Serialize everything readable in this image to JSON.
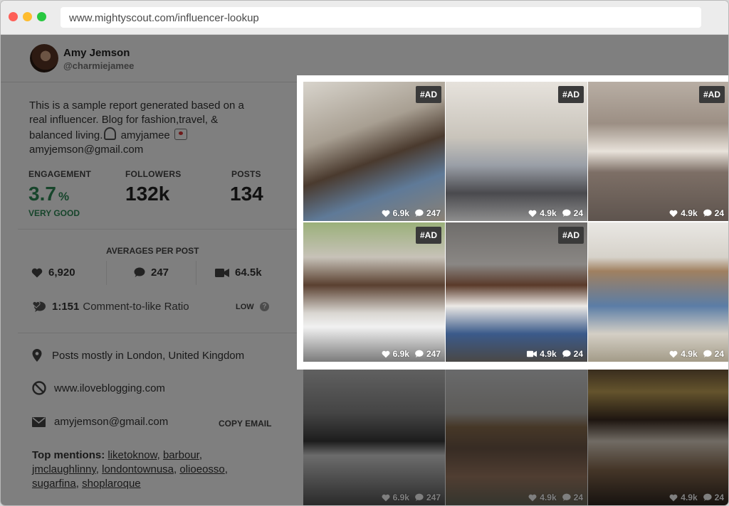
{
  "browser": {
    "url": "www.mightyscout.com/influencer-lookup"
  },
  "profile": {
    "name": "Amy Jemson",
    "handle": "@charmiejamee"
  },
  "bio": {
    "line1": "This is a sample report generated based on a",
    "line2": "real influencer. Blog for fashion,travel, &",
    "line3_text": "balanced living.",
    "line3_handle": "amyjamee",
    "line4": "amyjemson@gmail.com"
  },
  "stats": {
    "engagement_label": "ENGAGEMENT",
    "engagement_value": "3.7",
    "engagement_unit": "%",
    "engagement_rating": "VERY GOOD",
    "followers_label": "FOLLOWERS",
    "followers_value": "132k",
    "posts_label": "POSTS",
    "posts_value": "134"
  },
  "averages": {
    "title": "AVERAGES PER POST",
    "likes": "6,920",
    "comments": "247",
    "video_views": "64.5k",
    "ratio_value": "1:151",
    "ratio_label": "Comment-to-like Ratio",
    "ratio_rating": "LOW",
    "help": "?"
  },
  "info": {
    "location": "Posts mostly in London, United Kingdom",
    "website": "www.iloveblogging.com",
    "email": "amyjemson@gmail.com",
    "copy_email": "COPY EMAIL"
  },
  "mentions": {
    "label": "Top mentions:",
    "items": [
      "liketoknow",
      "barbour",
      "jmclaughlinny",
      "londontownusa",
      "olioeosso",
      "sugarfina",
      "shoplaroque"
    ]
  },
  "posts": [
    {
      "ad": "#AD",
      "likes": "6.9k",
      "comments": "247"
    },
    {
      "ad": "#AD",
      "likes": "4.9k",
      "comments": "24"
    },
    {
      "ad": "#AD",
      "likes": "4.9k",
      "comments": "24"
    },
    {
      "ad": "#AD",
      "likes": "6.9k",
      "comments": "247"
    },
    {
      "ad": "#AD",
      "views": "4.9k",
      "comments": "24"
    },
    {
      "likes": "4.9k",
      "comments": "24"
    },
    {
      "likes": "6.9k",
      "comments": "247"
    },
    {
      "likes": "4.9k",
      "comments": "24"
    },
    {
      "likes": "4.9k",
      "comments": "24"
    }
  ],
  "colors": {
    "engagement": "#2e8b57",
    "overlay": "rgba(0,0,0,0.5)"
  }
}
